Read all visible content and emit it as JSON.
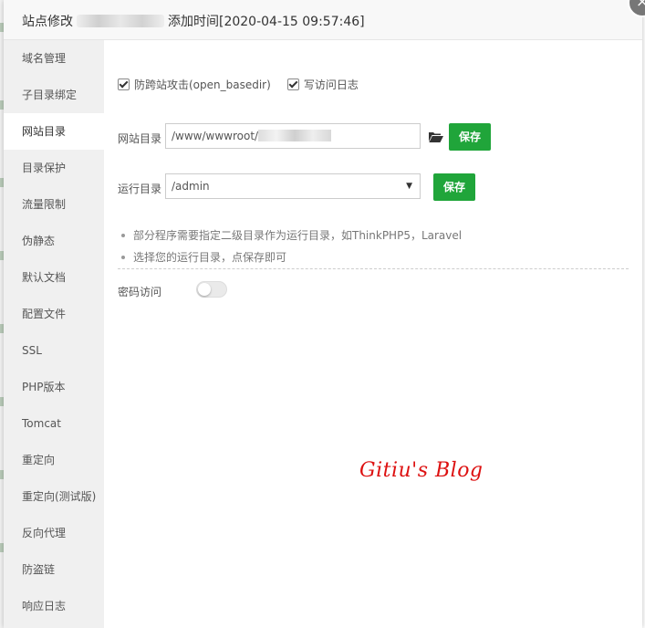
{
  "dialog": {
    "title_prefix": "站点修改",
    "title_suffix": "添加时间[2020-04-15 09:57:46]",
    "close_icon": "×"
  },
  "sidebar": {
    "items": [
      {
        "label": "域名管理"
      },
      {
        "label": "子目录绑定"
      },
      {
        "label": "网站目录",
        "active": true
      },
      {
        "label": "目录保护"
      },
      {
        "label": "流量限制"
      },
      {
        "label": "伪静态"
      },
      {
        "label": "默认文档"
      },
      {
        "label": "配置文件"
      },
      {
        "label": "SSL"
      },
      {
        "label": "PHP版本"
      },
      {
        "label": "Tomcat"
      },
      {
        "label": "重定向"
      },
      {
        "label": "重定向(测试版)"
      },
      {
        "label": "反向代理"
      },
      {
        "label": "防盗链"
      },
      {
        "label": "响应日志"
      }
    ]
  },
  "main": {
    "checkboxes": [
      {
        "label": "防跨站攻击(open_basedir)",
        "checked": true
      },
      {
        "label": "写访问日志",
        "checked": true
      }
    ],
    "site_dir": {
      "label": "网站目录",
      "value": "/www/wwwroot/",
      "folder_icon": "folder-open-icon",
      "save_label": "保存"
    },
    "run_dir": {
      "label": "运行目录",
      "selected": "/admin",
      "arrow": "▼",
      "save_label": "保存"
    },
    "tips": [
      "部分程序需要指定二级目录作为运行目录，如ThinkPHP5，Laravel",
      "选择您的运行目录，点保存即可"
    ],
    "password_access": {
      "label": "密码访问",
      "enabled": false
    }
  },
  "watermark": "Gitiu's Blog",
  "colors": {
    "accent": "#20a53a",
    "watermark": "#dd1111"
  }
}
